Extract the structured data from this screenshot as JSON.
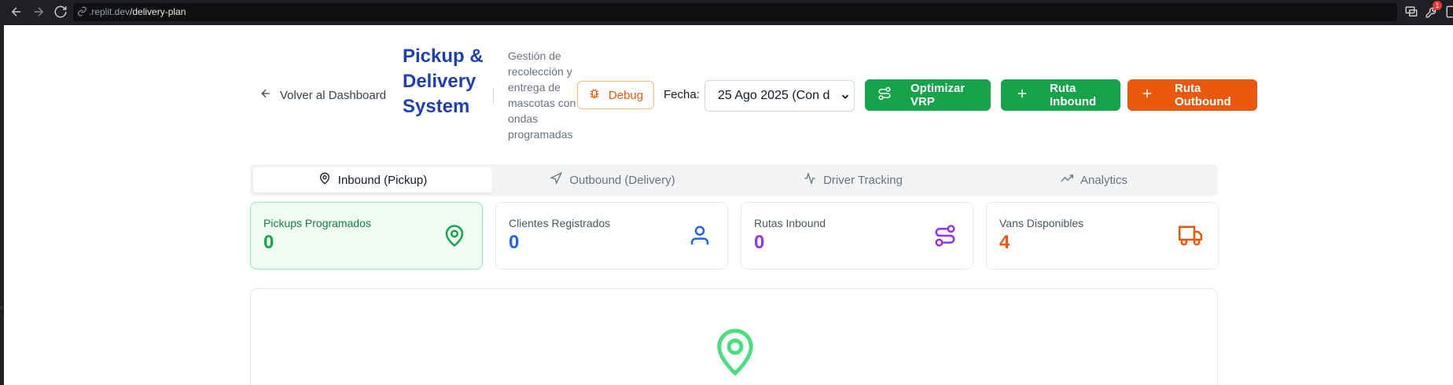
{
  "browser": {
    "url_prefix": ".replit.dev",
    "url_path": "/delivery-plan",
    "extension_badge": "1"
  },
  "header": {
    "back_label": "Volver al Dashboard",
    "title": "Pickup & Delivery System",
    "subtitle": "Gestión de recolección y entrega de mascotas con ondas programadas",
    "debug_label": "Debug",
    "date_label": "Fecha:",
    "date_value": "25 Ago 2025 (Con d",
    "optimize_label": "Optimizar VRP",
    "inbound_label": "Ruta Inbound",
    "outbound_label": "Ruta Outbound"
  },
  "tabs": [
    {
      "label": "Inbound (Pickup)",
      "icon": "map-pin-icon",
      "active": true
    },
    {
      "label": "Outbound (Delivery)",
      "icon": "navigation-icon",
      "active": false
    },
    {
      "label": "Driver Tracking",
      "icon": "activity-icon",
      "active": false
    },
    {
      "label": "Analytics",
      "icon": "trending-up-icon",
      "active": false
    }
  ],
  "stats": [
    {
      "label": "Pickups Programados",
      "value": "0",
      "icon": "map-pin-icon",
      "color": "#16a34a"
    },
    {
      "label": "Clientes Registrados",
      "value": "0",
      "icon": "user-icon",
      "color": "#2563eb"
    },
    {
      "label": "Rutas Inbound",
      "value": "0",
      "icon": "route-icon",
      "color": "#9333ea"
    },
    {
      "label": "Vans Disponibles",
      "value": "4",
      "icon": "truck-icon",
      "color": "#ea580c"
    }
  ],
  "empty_state": {
    "icon": "map-pin-icon",
    "color": "#4ade80"
  }
}
